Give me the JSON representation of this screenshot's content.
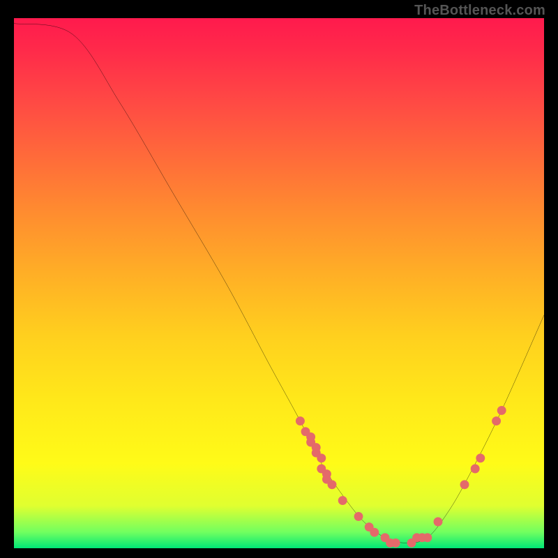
{
  "watermark_text": "TheBottleneck.com",
  "chart_data": {
    "type": "line",
    "title": "",
    "xlabel": "",
    "ylabel": "",
    "xlim": [
      0,
      100
    ],
    "ylim": [
      0,
      100
    ],
    "series": [
      {
        "name": "bottleneck-curve",
        "x": [
          0,
          11,
          20,
          30,
          40,
          48,
          54,
          58,
          62,
          66,
          70,
          74,
          78,
          82,
          86,
          92,
          100
        ],
        "values": [
          99,
          97,
          84,
          67,
          50,
          35,
          24,
          16,
          10,
          5,
          2,
          1,
          2,
          7,
          14,
          26,
          44
        ]
      }
    ],
    "scatter_points": {
      "name": "marker-dots",
      "x": [
        54,
        55,
        56,
        56,
        57,
        57,
        58,
        58,
        59,
        59,
        60,
        62,
        65,
        67,
        68,
        70,
        71,
        72,
        75,
        76,
        77,
        78,
        80,
        85,
        87,
        88,
        91,
        92
      ],
      "y": [
        24,
        22,
        21,
        20,
        19,
        18,
        17,
        15,
        14,
        13,
        12,
        9,
        6,
        4,
        3,
        2,
        1,
        1,
        1,
        2,
        2,
        2,
        5,
        12,
        15,
        17,
        24,
        26
      ],
      "radius": 3.5,
      "color": "#e46a6a"
    },
    "colors": {
      "curve_stroke": "#000000",
      "dot_fill": "#e46a6a",
      "background_top": "#ff1a4d",
      "background_bottom": "#00e676"
    }
  }
}
